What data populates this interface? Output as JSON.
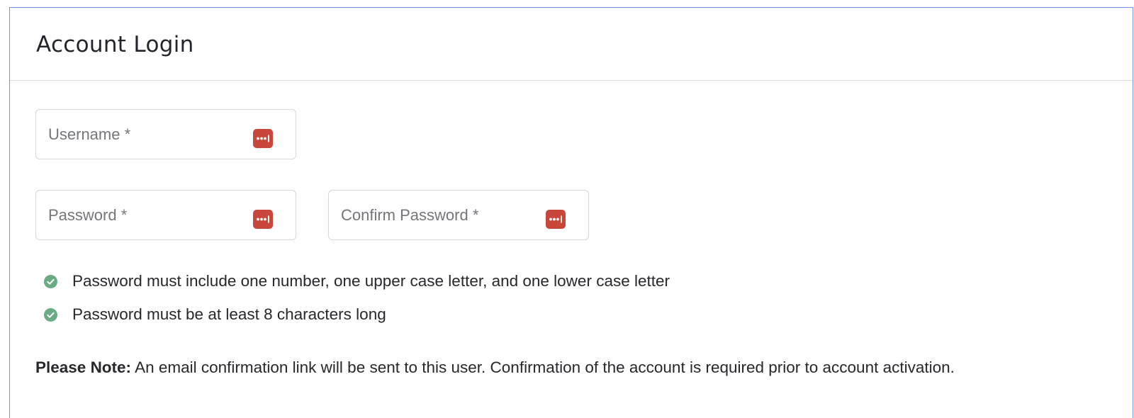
{
  "header": {
    "title": "Account Login"
  },
  "form": {
    "username": {
      "placeholder": "Username *",
      "value": ""
    },
    "password": {
      "placeholder": "Password *",
      "value": ""
    },
    "confirm_password": {
      "placeholder": "Confirm Password *",
      "value": ""
    },
    "field_icon": "password-manager-key-icon"
  },
  "rules": [
    {
      "icon": "check-circle-icon",
      "text": "Password must include one number, one upper case letter, and one lower case letter",
      "status": "met"
    },
    {
      "icon": "check-circle-icon",
      "text": "Password must be at least 8 characters long",
      "status": "met"
    }
  ],
  "note": {
    "label": "Please Note:",
    "text": " An email confirmation link will be sent to this user. Confirmation of the account is required prior to account activation."
  },
  "colors": {
    "panel_border": "#7b8fe6",
    "key_icon_bg": "#c9463a",
    "check_icon_bg": "#6aab84"
  }
}
